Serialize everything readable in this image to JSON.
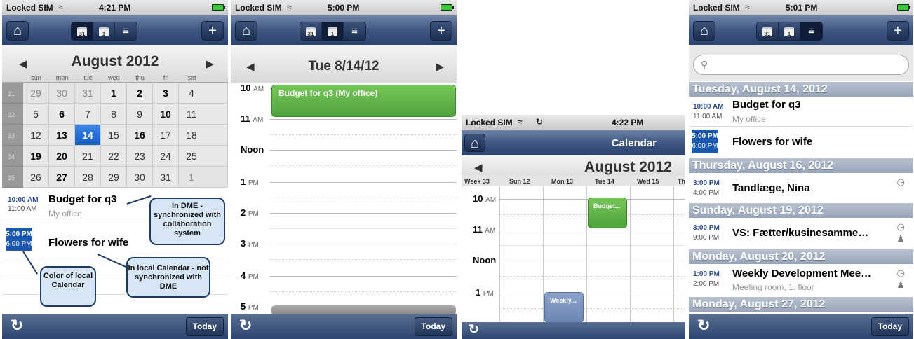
{
  "screen1": {
    "status": {
      "carrier": "Locked SIM",
      "time": "4:21 PM"
    },
    "month_title": "August 2012",
    "weekdays": [
      "sun",
      "mon",
      "tue",
      "wed",
      "thu",
      "fri",
      "sat"
    ],
    "weeks": [
      {
        "num": "31",
        "days": [
          "29",
          "30",
          "31",
          "1",
          "2",
          "3",
          "4"
        ]
      },
      {
        "num": "32",
        "days": [
          "5",
          "6",
          "7",
          "8",
          "9",
          "10",
          "11"
        ]
      },
      {
        "num": "33",
        "days": [
          "12",
          "13",
          "14",
          "15",
          "16",
          "17",
          "18"
        ]
      },
      {
        "num": "34",
        "days": [
          "19",
          "20",
          "21",
          "22",
          "23",
          "24",
          "25"
        ]
      },
      {
        "num": "35",
        "days": [
          "26",
          "27",
          "28",
          "29",
          "30",
          "31",
          "1"
        ]
      }
    ],
    "events": [
      {
        "start": "10:00 AM",
        "end": "11:00 AM",
        "title": "Budget for q3",
        "location": "My office"
      },
      {
        "start": "5:00 PM",
        "end": "6:00 PM",
        "title": "Flowers for wife"
      }
    ],
    "callouts": {
      "dme": "In DME - synchronized with collaboration system",
      "local": "In local Calendar - not synchronized with DME",
      "color": "Color of local Calendar"
    },
    "today_label": "Today"
  },
  "screen2": {
    "status": {
      "carrier": "Locked SIM",
      "time": "5:00 PM"
    },
    "day_title": "Tue 8/14/12",
    "hours": [
      {
        "num": "10",
        "suffix": "AM"
      },
      {
        "num": "11",
        "suffix": "AM"
      },
      {
        "num": "Noon",
        "suffix": ""
      },
      {
        "num": "1",
        "suffix": "PM"
      },
      {
        "num": "2",
        "suffix": "PM"
      },
      {
        "num": "3",
        "suffix": "PM"
      },
      {
        "num": "4",
        "suffix": "PM"
      },
      {
        "num": "5",
        "suffix": "PM"
      }
    ],
    "event": "Budget for q3 (My office)",
    "today_label": "Today"
  },
  "screen3": {
    "status": {
      "carrier": "Locked SIM",
      "time": "4:22 PM"
    },
    "nav_title": "Calendar",
    "month_title": "August 2012",
    "columns": [
      "Week 33",
      "Sun 12",
      "Mon 13",
      "Tue 14",
      "Wed 15",
      "Th"
    ],
    "hours": [
      {
        "num": "10",
        "suffix": "AM"
      },
      {
        "num": "11",
        "suffix": "AM"
      },
      {
        "num": "Noon",
        "suffix": ""
      },
      {
        "num": "1",
        "suffix": "PM"
      }
    ],
    "event_green": "Budget...",
    "event_blue": "Weekly..."
  },
  "screen4": {
    "status": {
      "carrier": "Locked SIM",
      "time": "5:01 PM"
    },
    "sections": [
      {
        "header": "Tuesday, August 14, 2012"
      },
      {
        "header": "Thursday, August 16, 2012"
      },
      {
        "header": "Sunday, August 19, 2012"
      },
      {
        "header": "Monday, August 20, 2012"
      },
      {
        "header": "Monday, August 27, 2012"
      }
    ],
    "items": [
      {
        "start": "10:00 AM",
        "end": "11:00 AM",
        "title": "Budget for q3",
        "location": "My office"
      },
      {
        "start": "5:00 PM",
        "end": "6:00 PM",
        "title": "Flowers for wife"
      },
      {
        "start": "3:00 PM",
        "end": "4:00 PM",
        "title": "Tandlæge, Nina"
      },
      {
        "start": "3:00 PM",
        "end": "9:00 PM",
        "title": "VS: Fætter/kusinesamme…"
      },
      {
        "start": "1:00 PM",
        "end": "2:00 PM",
        "title": "Weekly Development Mee…",
        "location": "Meeting room, 1. floor"
      }
    ],
    "today_label": "Today"
  }
}
